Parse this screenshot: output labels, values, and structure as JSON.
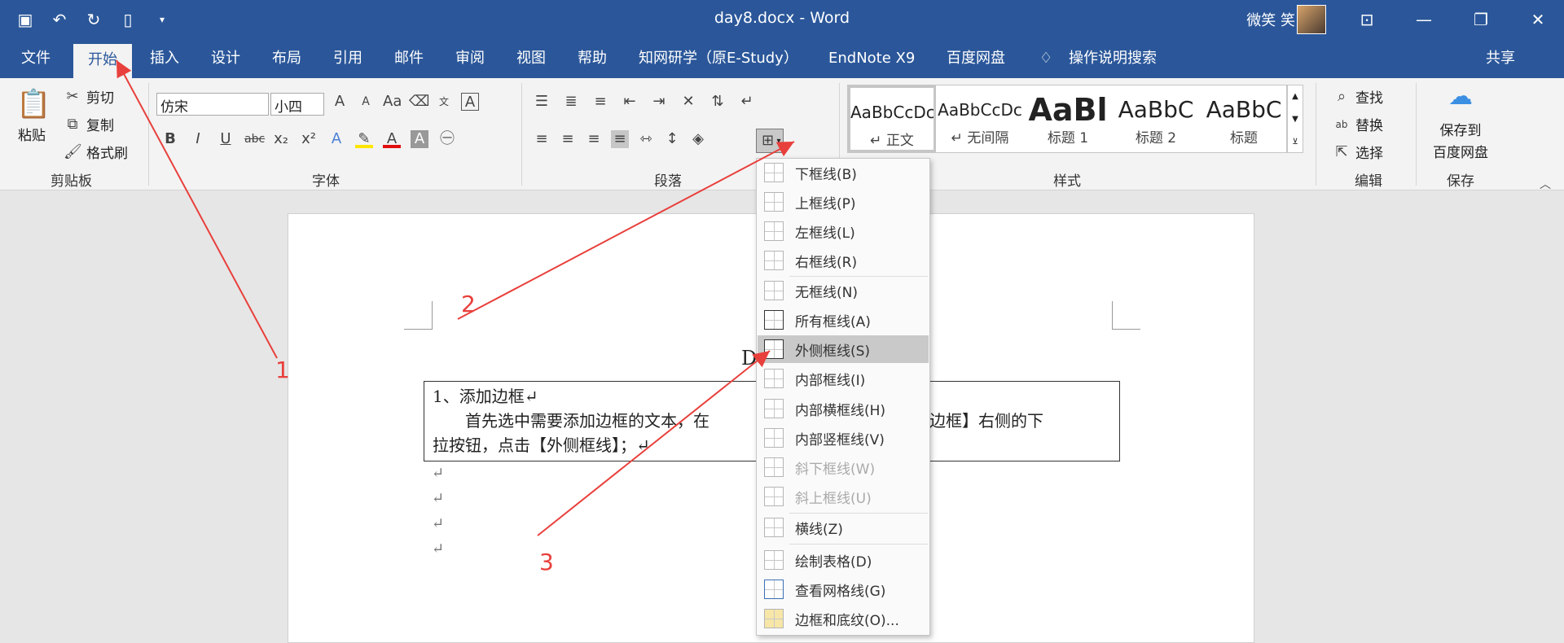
{
  "window": {
    "title": "day8.docx - Word",
    "user": "微笑 笑"
  },
  "tabs": [
    "文件",
    "开始",
    "插入",
    "设计",
    "布局",
    "引用",
    "邮件",
    "审阅",
    "视图",
    "帮助",
    "知网研学（原E-Study）",
    "EndNote X9",
    "百度网盘",
    "操作说明搜索",
    "共享"
  ],
  "clipboard": {
    "paste": "粘贴",
    "cut": "剪切",
    "copy": "复制",
    "format_painter": "格式刷",
    "label": "剪贴板"
  },
  "font": {
    "name": "仿宋",
    "size": "小四",
    "label": "字体"
  },
  "paragraph": {
    "label": "段落"
  },
  "styles": {
    "label": "样式",
    "items": [
      {
        "preview": "AaBbCcDc",
        "name": "↵ 正文"
      },
      {
        "preview": "AaBbCcDc",
        "name": "↵ 无间隔"
      },
      {
        "preview": "AaBl",
        "name": "标题 1"
      },
      {
        "preview": "AaBbC",
        "name": "标题 2"
      },
      {
        "preview": "AaBbC",
        "name": "标题"
      }
    ]
  },
  "editing": {
    "find": "查找",
    "replace": "替换",
    "select": "选择",
    "label": "编辑"
  },
  "save": {
    "button": "保存到\n百度网盘",
    "line1": "保存到",
    "line2": "百度网盘",
    "label": "保存"
  },
  "document": {
    "title": "Day8 边",
    "line1": "1、添加边框↵",
    "line2a": "首先选中需要添加边框的文本，在",
    "line2b": "点击【边框】右侧的下",
    "line3": "拉按钮，点击【外侧框线】；↵",
    "para_mark": "↵"
  },
  "border_menu": {
    "items": [
      {
        "label": "下框线(B)",
        "disabled": false
      },
      {
        "label": "上框线(P)",
        "disabled": false
      },
      {
        "label": "左框线(L)",
        "disabled": false
      },
      {
        "label": "右框线(R)",
        "disabled": false
      },
      {
        "label": "无框线(N)",
        "disabled": false
      },
      {
        "label": "所有框线(A)",
        "disabled": false
      },
      {
        "label": "外侧框线(S)",
        "disabled": false
      },
      {
        "label": "内部框线(I)",
        "disabled": false
      },
      {
        "label": "内部横框线(H)",
        "disabled": false
      },
      {
        "label": "内部竖框线(V)",
        "disabled": false
      },
      {
        "label": "斜下框线(W)",
        "disabled": true
      },
      {
        "label": "斜上框线(U)",
        "disabled": true
      },
      {
        "label": "横线(Z)",
        "disabled": false
      },
      {
        "label": "绘制表格(D)",
        "disabled": false
      },
      {
        "label": "查看网格线(G)",
        "disabled": false
      },
      {
        "label": "边框和底纹(O)...",
        "disabled": false
      }
    ],
    "highlighted": "外侧框线(S)"
  },
  "annotations": [
    "1",
    "2",
    "3"
  ],
  "colors": {
    "accent": "#2b579a",
    "arrow": "#e8403c"
  }
}
